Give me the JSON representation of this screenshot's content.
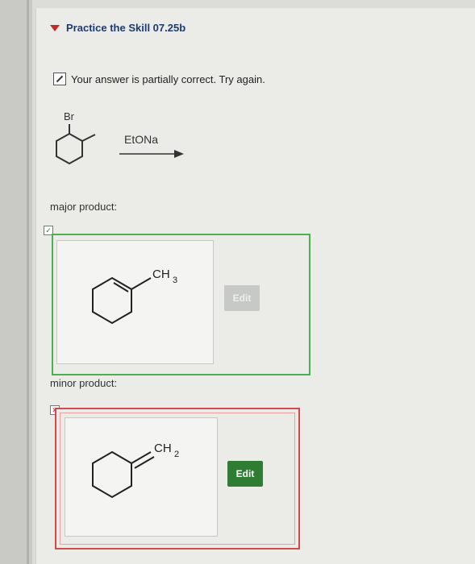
{
  "section": {
    "title": "Practice the Skill 07.25b"
  },
  "feedback": {
    "text": "Your answer is partially correct.  Try again."
  },
  "reaction": {
    "substituent": "Br",
    "reagent": "EtONa"
  },
  "major": {
    "label": "major product:",
    "status": "✓",
    "substituent": "CH",
    "subscript": "3",
    "edit_label": "Edit"
  },
  "minor": {
    "label": "minor product:",
    "status": "✕",
    "substituent": "CH",
    "subscript": "2",
    "edit_label": "Edit"
  },
  "colors": {
    "correct": "#4caf50",
    "incorrect": "#d24a4a",
    "title": "#1f3a70",
    "edit": "#2e7d32"
  }
}
